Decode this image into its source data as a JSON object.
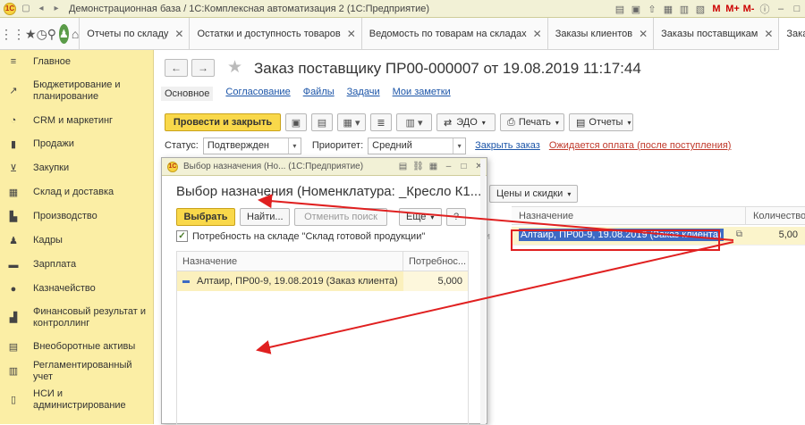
{
  "titlebar": {
    "app_title": "Демонстрационная база / 1С:Комплексная автоматизация 2  (1С:Предприятие)",
    "logo": "1C"
  },
  "nav_icons": [
    "apps-grid-icon",
    "star-icon",
    "history-icon",
    "search-icon",
    "user-icon",
    "home-icon"
  ],
  "tabs": [
    {
      "label": "Отчеты по складу"
    },
    {
      "label": "Остатки и доступность товаров"
    },
    {
      "label": "Ведомость по товарам на складах"
    },
    {
      "label": "Заказы клиентов"
    },
    {
      "label": "Заказы поставщикам"
    },
    {
      "label": "Зака"
    }
  ],
  "sidebar": {
    "items": [
      {
        "label": "Главное"
      },
      {
        "label": "Бюджетирование и планирование"
      },
      {
        "label": "CRM и маркетинг"
      },
      {
        "label": "Продажи"
      },
      {
        "label": "Закупки"
      },
      {
        "label": "Склад и доставка"
      },
      {
        "label": "Производство"
      },
      {
        "label": "Кадры"
      },
      {
        "label": "Зарплата"
      },
      {
        "label": "Казначейство"
      },
      {
        "label": "Финансовый результат и контроллинг"
      },
      {
        "label": "Внеоборотные активы"
      },
      {
        "label": "Регламентированный учет"
      },
      {
        "label": "НСИ и администрирование"
      }
    ]
  },
  "document": {
    "title": "Заказ поставщику ПР00-000007 от 19.08.2019 11:17:44",
    "subnav": [
      "Основное",
      "Согласование",
      "Файлы",
      "Задачи",
      "Мои заметки"
    ],
    "post_close": "Провести и закрыть",
    "edo": "ЭДО",
    "print": "Печать",
    "reports": "Отчеты",
    "status_label": "Статус:",
    "status_value": "Подтвержден",
    "priority_label": "Приоритет:",
    "priority_value": "Средний",
    "close_order": "Закрыть заказ",
    "payment_wait": "Ожидается оплата (после поступления)",
    "prices_discounts": "Цены и скидки",
    "grid_col_purpose": "Назначение",
    "grid_col_qty": "Количество",
    "grid_left_fragment": "ки",
    "grid_purpose_value": "Алтаир, ПР00-9, 19.08.2019 (Заказ клиента)",
    "grid_qty_value": "5,00"
  },
  "dialog": {
    "window_title": "Выбор назначения (Но...   (1С:Предприятие)",
    "heading": "Выбор назначения (Номенклатура: _Кресло К1...",
    "select_btn": "Выбрать",
    "find_btn": "Найти...",
    "cancel_search_btn": "Отменить поиск",
    "more_btn": "Еще",
    "help_btn": "?",
    "checkbox_label": "Потребность на складе \"Склад готовой продукции\"",
    "checkbox_checked": true,
    "col_purpose": "Назначение",
    "col_need": "Потребнос...",
    "rows": [
      {
        "purpose": "Алтаир, ПР00-9, 19.08.2019 (Заказ клиента)",
        "need": "5,000"
      }
    ]
  },
  "colors": {
    "sidebar_bg": "#fbeea5",
    "accent_yellow": "#f9d84a",
    "link_blue": "#1c55a8",
    "annotation_red": "#e02020",
    "selection_blue": "#3d6ac4"
  }
}
